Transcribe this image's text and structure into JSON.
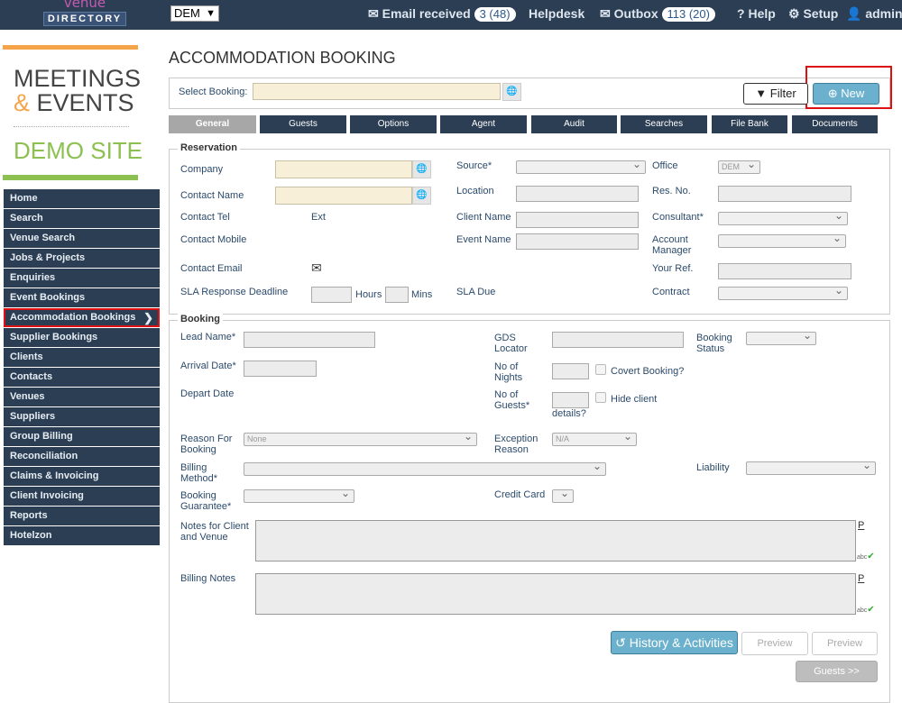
{
  "topbar": {
    "logo_line1": "venue",
    "logo_line2": "DIRECTORY",
    "org_selected": "DEM",
    "email_label": "Email received",
    "email_badge": "3 (48)",
    "helpdesk_label": "Helpdesk",
    "outbox_label": "Outbox",
    "outbox_badge": "113 (20)",
    "help_label": "Help",
    "setup_label": "Setup",
    "user_label": "admin"
  },
  "brand": {
    "line1": "MEETINGS",
    "amp": "&",
    "line2": "EVENTS",
    "site": "DEMO SITE"
  },
  "sidebar": {
    "items": [
      {
        "label": "Home"
      },
      {
        "label": "Search"
      },
      {
        "label": "Venue Search"
      },
      {
        "label": "Jobs & Projects"
      },
      {
        "label": "Enquiries"
      },
      {
        "label": "Event Bookings"
      },
      {
        "label": "Accommodation Bookings"
      },
      {
        "label": "Supplier Bookings"
      },
      {
        "label": "Clients"
      },
      {
        "label": "Contacts"
      },
      {
        "label": "Venues"
      },
      {
        "label": "Suppliers"
      },
      {
        "label": "Group Billing"
      },
      {
        "label": "Reconciliation"
      },
      {
        "label": "Claims & Invoicing"
      },
      {
        "label": "Client Invoicing"
      },
      {
        "label": "Reports"
      },
      {
        "label": "Hotelzon"
      }
    ],
    "active_index": 6
  },
  "page": {
    "title": "ACCOMMODATION BOOKING",
    "select_booking_label": "Select Booking:",
    "filter_label": "Filter",
    "new_label": "New"
  },
  "tabs": [
    "General",
    "Guests",
    "Options",
    "Agent",
    "Audit",
    "Searches",
    "File Bank",
    "Documents"
  ],
  "reservation": {
    "legend": "Reservation",
    "company": "Company",
    "contact_name": "Contact Name",
    "contact_tel": "Contact Tel",
    "ext": "Ext",
    "contact_mobile": "Contact Mobile",
    "contact_email": "Contact Email",
    "sla_deadline": "SLA Response Deadline",
    "hours": "Hours",
    "mins": "Mins",
    "source": "Source*",
    "location": "Location",
    "client_name": "Client Name",
    "event_name": "Event Name",
    "sla_due": "SLA Due",
    "office": "Office",
    "office_value": "DEM",
    "res_no": "Res. No.",
    "consultant": "Consultant*",
    "account_manager": "Account Manager",
    "your_ref": "Your Ref.",
    "contract": "Contract"
  },
  "booking": {
    "legend": "Booking",
    "lead_name": "Lead Name*",
    "arrival_date": "Arrival Date*",
    "depart_date": "Depart Date",
    "gds_locator": "GDS Locator",
    "no_nights": "No of Nights",
    "covert": "Covert Booking?",
    "no_guests": "No of Guests*",
    "hide_client": "Hide client",
    "details": "details?",
    "booking_status": "Booking Status",
    "reason_for_booking": "Reason For Booking",
    "reason_value": "None",
    "exception_reason": "Exception Reason",
    "exception_value": "N/A",
    "billing_method": "Billing Method*",
    "liability": "Liability",
    "booking_guarantee": "Booking Guarantee*",
    "credit_card": "Credit Card",
    "notes_client_venue": "Notes for Client and Venue",
    "billing_notes": "Billing Notes",
    "p_link": "P",
    "abc": "abc"
  },
  "actions": {
    "history": "History & Activities",
    "preview1": "Preview",
    "preview2": "Preview",
    "guests_next": "Guests >>"
  }
}
